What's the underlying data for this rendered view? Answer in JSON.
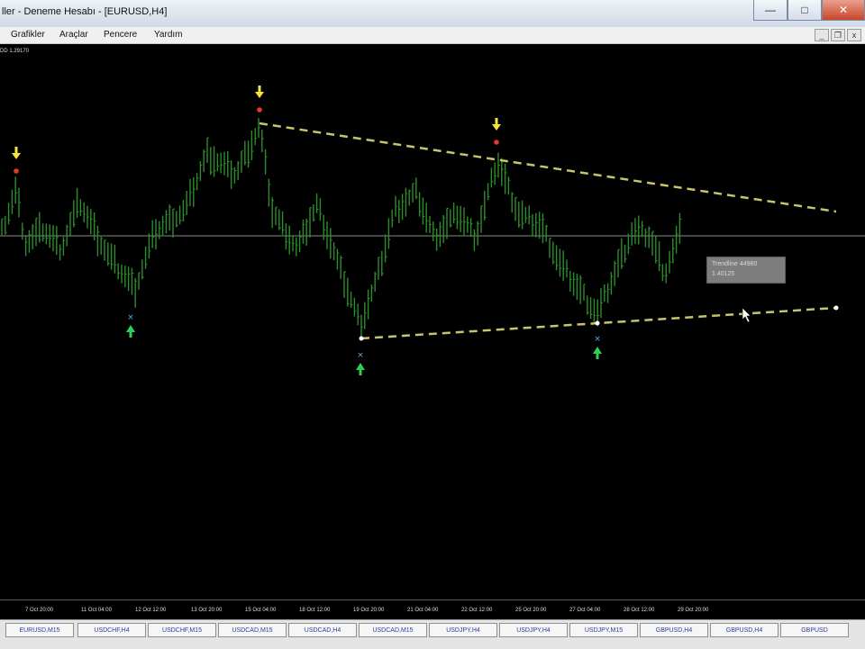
{
  "window": {
    "title": "ller - Deneme Hesabı - [EURUSD,H4]"
  },
  "menu": {
    "items": [
      "Grafikler",
      "Araçlar",
      "Pencere",
      "Yardım"
    ]
  },
  "chart": {
    "symbol_info": "DD 1.29170",
    "tooltip_line1": "Trendline 44980",
    "tooltip_line2": "1.40125",
    "colors": {
      "background": "#000000",
      "candles": "#2e8b2e",
      "trendline": "#c8c46a",
      "sell_arrow": "#f3e53a",
      "sell_marker": "#e23a2e",
      "buy_arrow": "#2ecf57",
      "buy_marker": "#59b0e8",
      "horizontal_line": "#8a8a8a"
    },
    "time_labels": [
      "7 Oct 20:00",
      "11 Oct 04:00",
      "12 Oct 12:00",
      "13 Oct 20:00",
      "15 Oct 04:00",
      "18 Oct 12:00",
      "19 Oct 20:00",
      "21 Oct 04:00",
      "22 Oct 12:00",
      "25 Oct 20:00",
      "27 Oct 04:00",
      "28 Oct 12:00",
      "29 Oct 20:00"
    ]
  },
  "tabs": [
    {
      "label": "EURUSD,M15",
      "active": false
    },
    {
      "label": "USDCHF,H4",
      "active": false
    },
    {
      "label": "USDCHF,M15",
      "active": false
    },
    {
      "label": "USDCAD,M15",
      "active": false
    },
    {
      "label": "USDCAD,H4",
      "active": false
    },
    {
      "label": "USDCAD,M15",
      "active": false
    },
    {
      "label": "USDJPY,H4",
      "active": false
    },
    {
      "label": "USDJPY,H4",
      "active": false
    },
    {
      "label": "USDJPY,M15",
      "active": false
    },
    {
      "label": "GBPUSD,H4",
      "active": false
    },
    {
      "label": "GBPUSD,H4",
      "active": false
    },
    {
      "label": "GBPUSD",
      "active": false
    }
  ]
}
